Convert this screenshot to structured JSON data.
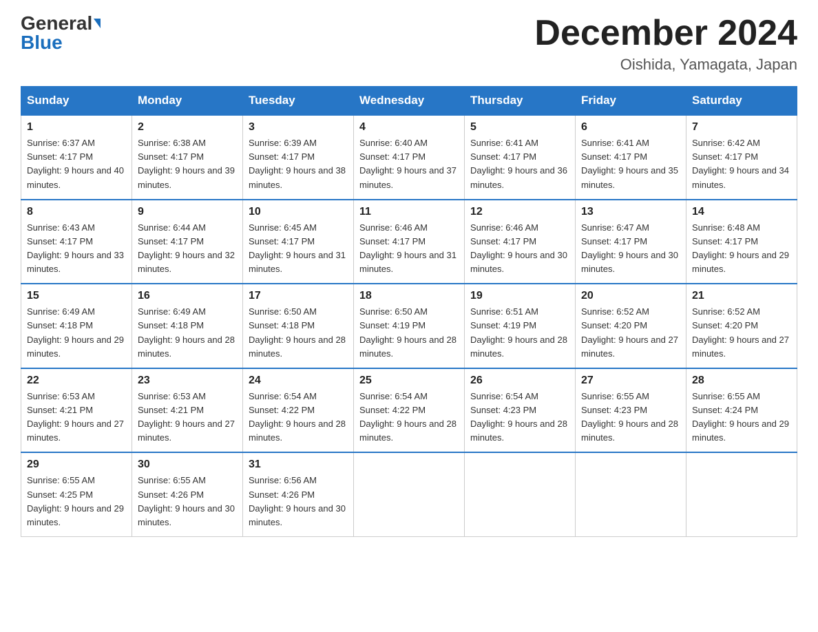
{
  "header": {
    "logo_general": "General",
    "logo_blue": "Blue",
    "title": "December 2024",
    "subtitle": "Oishida, Yamagata, Japan"
  },
  "days_of_week": [
    "Sunday",
    "Monday",
    "Tuesday",
    "Wednesday",
    "Thursday",
    "Friday",
    "Saturday"
  ],
  "weeks": [
    [
      {
        "num": "1",
        "sunrise": "6:37 AM",
        "sunset": "4:17 PM",
        "daylight": "9 hours and 40 minutes."
      },
      {
        "num": "2",
        "sunrise": "6:38 AM",
        "sunset": "4:17 PM",
        "daylight": "9 hours and 39 minutes."
      },
      {
        "num": "3",
        "sunrise": "6:39 AM",
        "sunset": "4:17 PM",
        "daylight": "9 hours and 38 minutes."
      },
      {
        "num": "4",
        "sunrise": "6:40 AM",
        "sunset": "4:17 PM",
        "daylight": "9 hours and 37 minutes."
      },
      {
        "num": "5",
        "sunrise": "6:41 AM",
        "sunset": "4:17 PM",
        "daylight": "9 hours and 36 minutes."
      },
      {
        "num": "6",
        "sunrise": "6:41 AM",
        "sunset": "4:17 PM",
        "daylight": "9 hours and 35 minutes."
      },
      {
        "num": "7",
        "sunrise": "6:42 AM",
        "sunset": "4:17 PM",
        "daylight": "9 hours and 34 minutes."
      }
    ],
    [
      {
        "num": "8",
        "sunrise": "6:43 AM",
        "sunset": "4:17 PM",
        "daylight": "9 hours and 33 minutes."
      },
      {
        "num": "9",
        "sunrise": "6:44 AM",
        "sunset": "4:17 PM",
        "daylight": "9 hours and 32 minutes."
      },
      {
        "num": "10",
        "sunrise": "6:45 AM",
        "sunset": "4:17 PM",
        "daylight": "9 hours and 31 minutes."
      },
      {
        "num": "11",
        "sunrise": "6:46 AM",
        "sunset": "4:17 PM",
        "daylight": "9 hours and 31 minutes."
      },
      {
        "num": "12",
        "sunrise": "6:46 AM",
        "sunset": "4:17 PM",
        "daylight": "9 hours and 30 minutes."
      },
      {
        "num": "13",
        "sunrise": "6:47 AM",
        "sunset": "4:17 PM",
        "daylight": "9 hours and 30 minutes."
      },
      {
        "num": "14",
        "sunrise": "6:48 AM",
        "sunset": "4:17 PM",
        "daylight": "9 hours and 29 minutes."
      }
    ],
    [
      {
        "num": "15",
        "sunrise": "6:49 AM",
        "sunset": "4:18 PM",
        "daylight": "9 hours and 29 minutes."
      },
      {
        "num": "16",
        "sunrise": "6:49 AM",
        "sunset": "4:18 PM",
        "daylight": "9 hours and 28 minutes."
      },
      {
        "num": "17",
        "sunrise": "6:50 AM",
        "sunset": "4:18 PM",
        "daylight": "9 hours and 28 minutes."
      },
      {
        "num": "18",
        "sunrise": "6:50 AM",
        "sunset": "4:19 PM",
        "daylight": "9 hours and 28 minutes."
      },
      {
        "num": "19",
        "sunrise": "6:51 AM",
        "sunset": "4:19 PM",
        "daylight": "9 hours and 28 minutes."
      },
      {
        "num": "20",
        "sunrise": "6:52 AM",
        "sunset": "4:20 PM",
        "daylight": "9 hours and 27 minutes."
      },
      {
        "num": "21",
        "sunrise": "6:52 AM",
        "sunset": "4:20 PM",
        "daylight": "9 hours and 27 minutes."
      }
    ],
    [
      {
        "num": "22",
        "sunrise": "6:53 AM",
        "sunset": "4:21 PM",
        "daylight": "9 hours and 27 minutes."
      },
      {
        "num": "23",
        "sunrise": "6:53 AM",
        "sunset": "4:21 PM",
        "daylight": "9 hours and 27 minutes."
      },
      {
        "num": "24",
        "sunrise": "6:54 AM",
        "sunset": "4:22 PM",
        "daylight": "9 hours and 28 minutes."
      },
      {
        "num": "25",
        "sunrise": "6:54 AM",
        "sunset": "4:22 PM",
        "daylight": "9 hours and 28 minutes."
      },
      {
        "num": "26",
        "sunrise": "6:54 AM",
        "sunset": "4:23 PM",
        "daylight": "9 hours and 28 minutes."
      },
      {
        "num": "27",
        "sunrise": "6:55 AM",
        "sunset": "4:23 PM",
        "daylight": "9 hours and 28 minutes."
      },
      {
        "num": "28",
        "sunrise": "6:55 AM",
        "sunset": "4:24 PM",
        "daylight": "9 hours and 29 minutes."
      }
    ],
    [
      {
        "num": "29",
        "sunrise": "6:55 AM",
        "sunset": "4:25 PM",
        "daylight": "9 hours and 29 minutes."
      },
      {
        "num": "30",
        "sunrise": "6:55 AM",
        "sunset": "4:26 PM",
        "daylight": "9 hours and 30 minutes."
      },
      {
        "num": "31",
        "sunrise": "6:56 AM",
        "sunset": "4:26 PM",
        "daylight": "9 hours and 30 minutes."
      },
      null,
      null,
      null,
      null
    ]
  ]
}
